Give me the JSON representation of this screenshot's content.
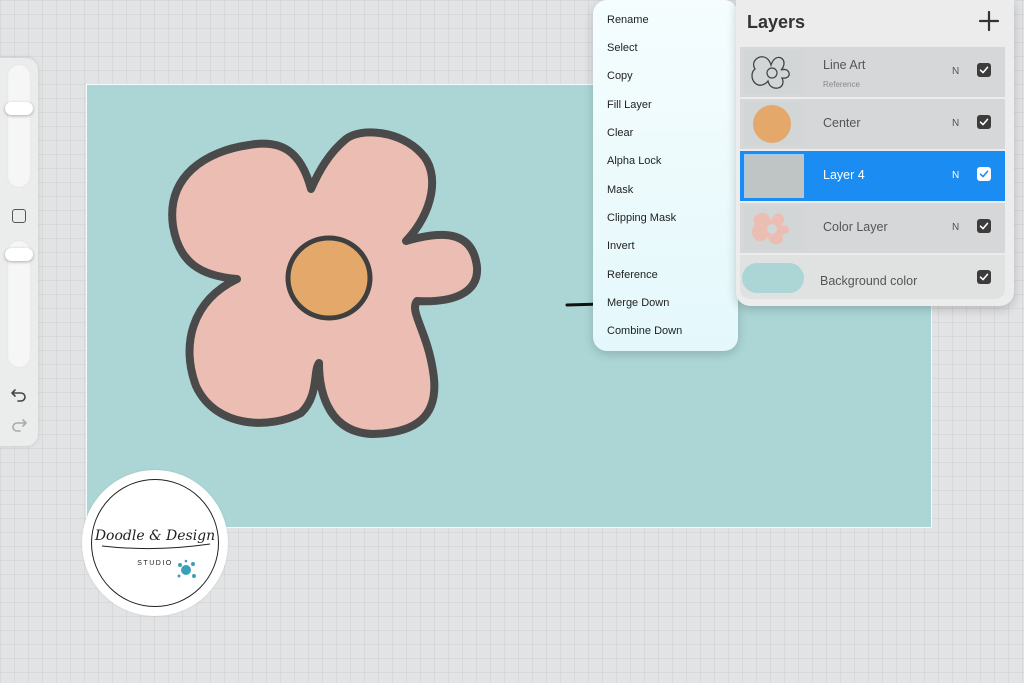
{
  "colors": {
    "canvas": "#acd6d6",
    "petal": "#ecbdb2",
    "center": "#e4a96a",
    "outline": "#4a4a4a",
    "active_layer": "#1a8cf2",
    "logo_splash": "#3aa0b8"
  },
  "layer_menu": {
    "items": [
      "Rename",
      "Select",
      "Copy",
      "Fill Layer",
      "Clear",
      "Alpha Lock",
      "Mask",
      "Clipping Mask",
      "Invert",
      "Reference",
      "Merge Down",
      "Combine Down"
    ]
  },
  "layers_panel": {
    "title": "Layers",
    "add_icon": "plus-icon",
    "layers": [
      {
        "name": "Line Art",
        "sub": "Reference",
        "blend": "N",
        "visible": true,
        "active": false,
        "thumb": "line-art"
      },
      {
        "name": "Center",
        "sub": "",
        "blend": "N",
        "visible": true,
        "active": false,
        "thumb": "center"
      },
      {
        "name": "Layer 4",
        "sub": "",
        "blend": "N",
        "visible": true,
        "active": true,
        "thumb": "blank"
      },
      {
        "name": "Color Layer",
        "sub": "",
        "blend": "N",
        "visible": true,
        "active": false,
        "thumb": "color"
      }
    ],
    "background": {
      "label": "Background color",
      "visible": true
    }
  },
  "sidebar": {
    "brush_size_icon": "slider-thumb",
    "opacity_icon": "slider-thumb",
    "modify_icon": "square-icon",
    "undo_icon": "undo-icon",
    "redo_icon": "redo-icon"
  },
  "logo": {
    "script_text": "Doodle & Design",
    "sub_text": "STUDIO"
  }
}
